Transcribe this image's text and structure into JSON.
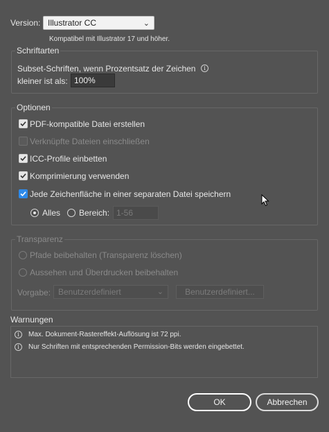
{
  "version": {
    "label": "Version:",
    "selected": "Illustrator CC",
    "note": "Kompatibel mit Illustrator 17 und höher."
  },
  "fonts": {
    "title": "Schriftarten",
    "subset_line1": "Subset-Schriften, wenn Prozentsatz der Zeichen",
    "subset_line2": "kleiner ist als:",
    "percent_value": "100%"
  },
  "options": {
    "title": "Optionen",
    "pdf_compatible": "PDF-kompatible Datei erstellen",
    "linked_files": "Verknüpfte Dateien einschließen",
    "icc_profiles": "ICC-Profile einbetten",
    "compression": "Komprimierung verwenden",
    "artboards_separate": "Jede Zeichenfläche in einer separaten Datei speichern",
    "all_label": "Alles",
    "range_label": "Bereich:",
    "range_value": "1-56"
  },
  "transparency": {
    "title": "Transparenz",
    "keep_paths": "Pfade beibehalten (Transparenz löschen)",
    "keep_appearance": "Aussehen und Überdrucken beibehalten",
    "preset_label": "Vorgabe:",
    "preset_value": "Benutzerdefiniert",
    "custom_button": "Benutzerdefiniert..."
  },
  "warnings": {
    "title": "Warnungen",
    "items": [
      "Max. Dokument-Rastereffekt-Auflösung ist 72 ppi.",
      "Nur Schriften mit entsprechenden Permission-Bits werden eingebettet."
    ]
  },
  "buttons": {
    "ok": "OK",
    "cancel": "Abbrechen"
  },
  "colors": {
    "background": "#535353",
    "accent_checkbox": "#2e8aea"
  }
}
